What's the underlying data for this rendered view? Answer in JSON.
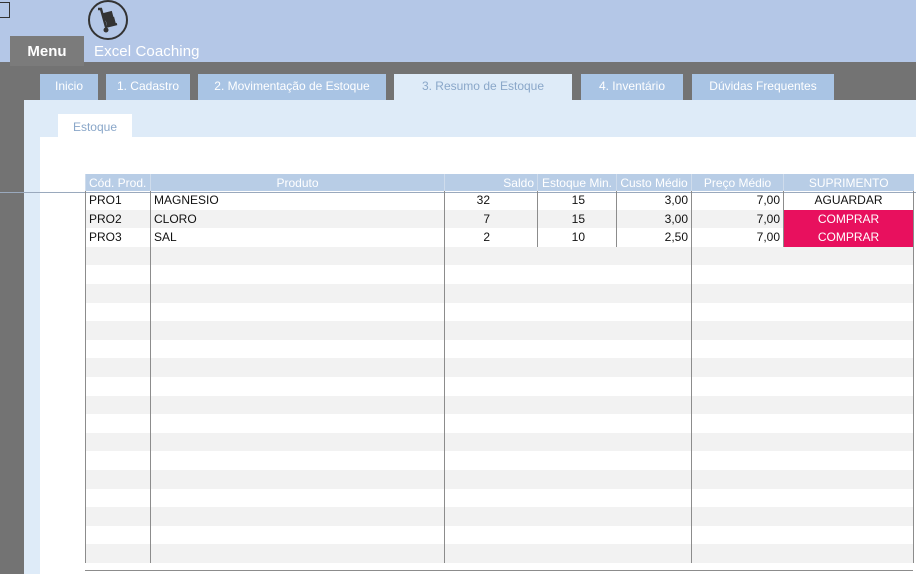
{
  "app": {
    "brand": "Excel Coaching",
    "menu_label": "Menu",
    "logo_icon": "hand-truck-icon"
  },
  "tabs": [
    {
      "label": "Inicio",
      "active": false
    },
    {
      "label": "1. Cadastro",
      "active": false
    },
    {
      "label": "2. Movimentação de Estoque",
      "active": false
    },
    {
      "label": "3. Resumo de Estoque",
      "active": true
    },
    {
      "label": "4. Inventário",
      "active": false
    },
    {
      "label": "Dúvidas Frequentes",
      "active": false
    }
  ],
  "subtab": {
    "label": "Estoque"
  },
  "table": {
    "columns": [
      "Cód. Prod.",
      "Produto",
      "Saldo",
      "Estoque Min.",
      "Custo Médio",
      "Preço Médio",
      "SUPRIMENTO"
    ],
    "rows": [
      {
        "cod": "PRO1",
        "produto": "MAGNESIO",
        "saldo": "32",
        "estoque_min": "15",
        "custo_medio": "3,00",
        "preco_medio": "7,00",
        "suprimento": "AGUARDAR",
        "buy": false
      },
      {
        "cod": "PRO2",
        "produto": "CLORO",
        "saldo": "7",
        "estoque_min": "15",
        "custo_medio": "3,00",
        "preco_medio": "7,00",
        "suprimento": "COMPRAR",
        "buy": true
      },
      {
        "cod": "PRO3",
        "produto": "SAL",
        "saldo": "2",
        "estoque_min": "10",
        "custo_medio": "2,50",
        "preco_medio": "7,00",
        "suprimento": "COMPRAR",
        "buy": true
      }
    ]
  },
  "colors": {
    "header_band": "#b4c7e7",
    "tab": "#a9c4e4",
    "panel": "#deebf8",
    "buy_highlight": "#e8105e",
    "dark_frame": "#737373"
  }
}
